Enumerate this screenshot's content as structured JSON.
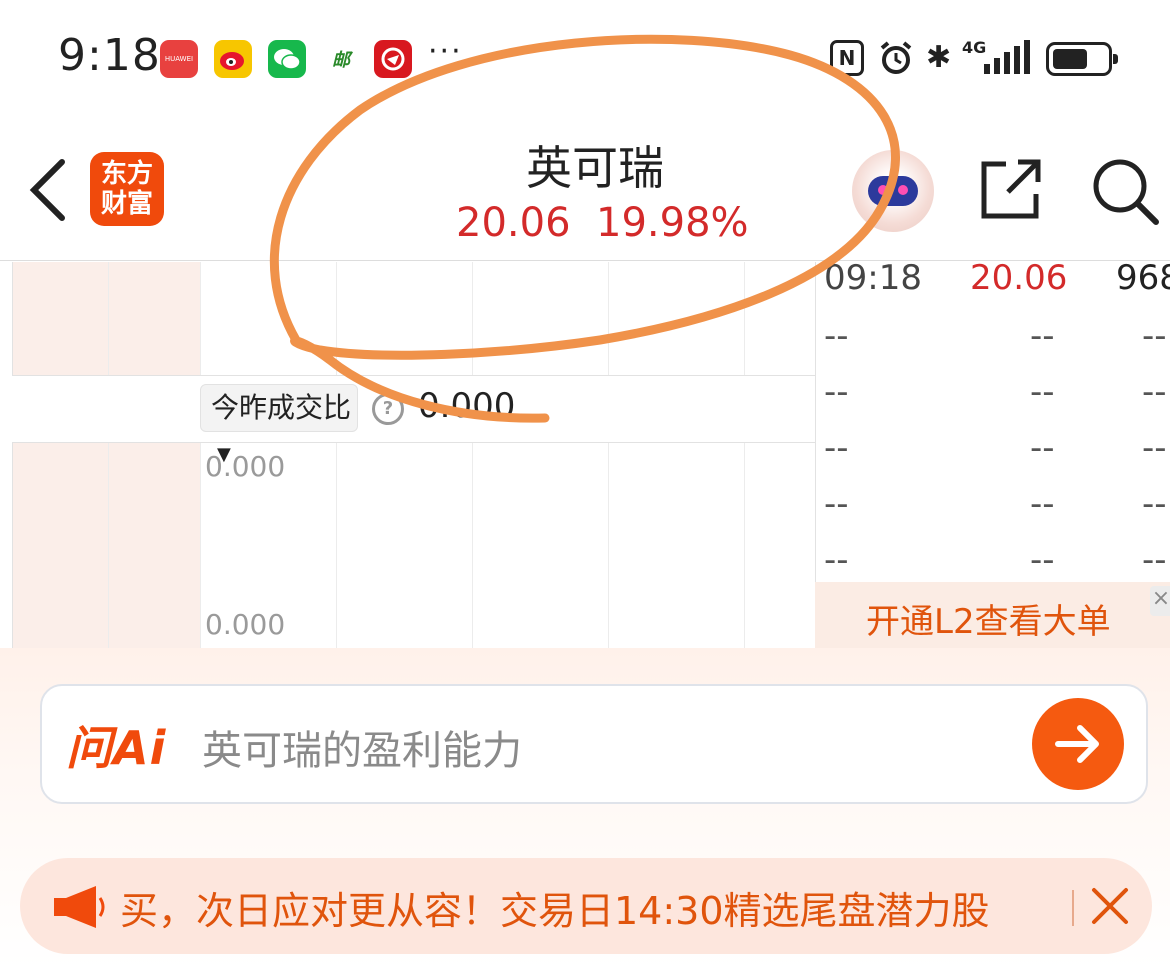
{
  "status_bar": {
    "time": "9:18",
    "more": "···",
    "apps": [
      {
        "name": "huawei-app-icon",
        "label": "HUAWEI"
      },
      {
        "name": "weibo-icon",
        "label": ""
      },
      {
        "name": "wechat-icon",
        "label": ""
      },
      {
        "name": "post-app-icon",
        "label": "邮"
      },
      {
        "name": "red-app-icon",
        "label": ""
      }
    ],
    "network": "4G",
    "icons": [
      "nfc-icon",
      "alarm-icon",
      "bluetooth-icon",
      "signal-icon",
      "battery-icon"
    ]
  },
  "header": {
    "logo_text_line1": "东方",
    "logo_text_line2": "财富",
    "stock_name": "英可瑞",
    "price": "20.06",
    "change_pct": "19.98%"
  },
  "chart": {
    "selector_label": "今昨成交比",
    "selector_caret": "▼",
    "info_icon": "?",
    "ratio_value": "0.000",
    "axis_top": "0.000",
    "axis_bottom": "0.000"
  },
  "trades": {
    "rows": [
      {
        "time": "09:18",
        "price": "20.06",
        "volume": "968"
      },
      {
        "time": "--",
        "price": "--",
        "volume": "--"
      },
      {
        "time": "--",
        "price": "--",
        "volume": "--"
      },
      {
        "time": "--",
        "price": "--",
        "volume": "--"
      },
      {
        "time": "--",
        "price": "--",
        "volume": "--"
      },
      {
        "time": "--",
        "price": "--",
        "volume": "--"
      }
    ],
    "l2_banner": "开通L2查看大单",
    "l2_close": "×"
  },
  "ai": {
    "logo": "问Ai",
    "query": "英可瑞的盈利能力"
  },
  "promo": {
    "text": "买，次日应对更从容！交易日14:30精选尾盘潜力股"
  },
  "colors": {
    "up_red": "#d32a2a",
    "brand_orange": "#f04a0c",
    "annotation_orange": "#f0924a"
  }
}
